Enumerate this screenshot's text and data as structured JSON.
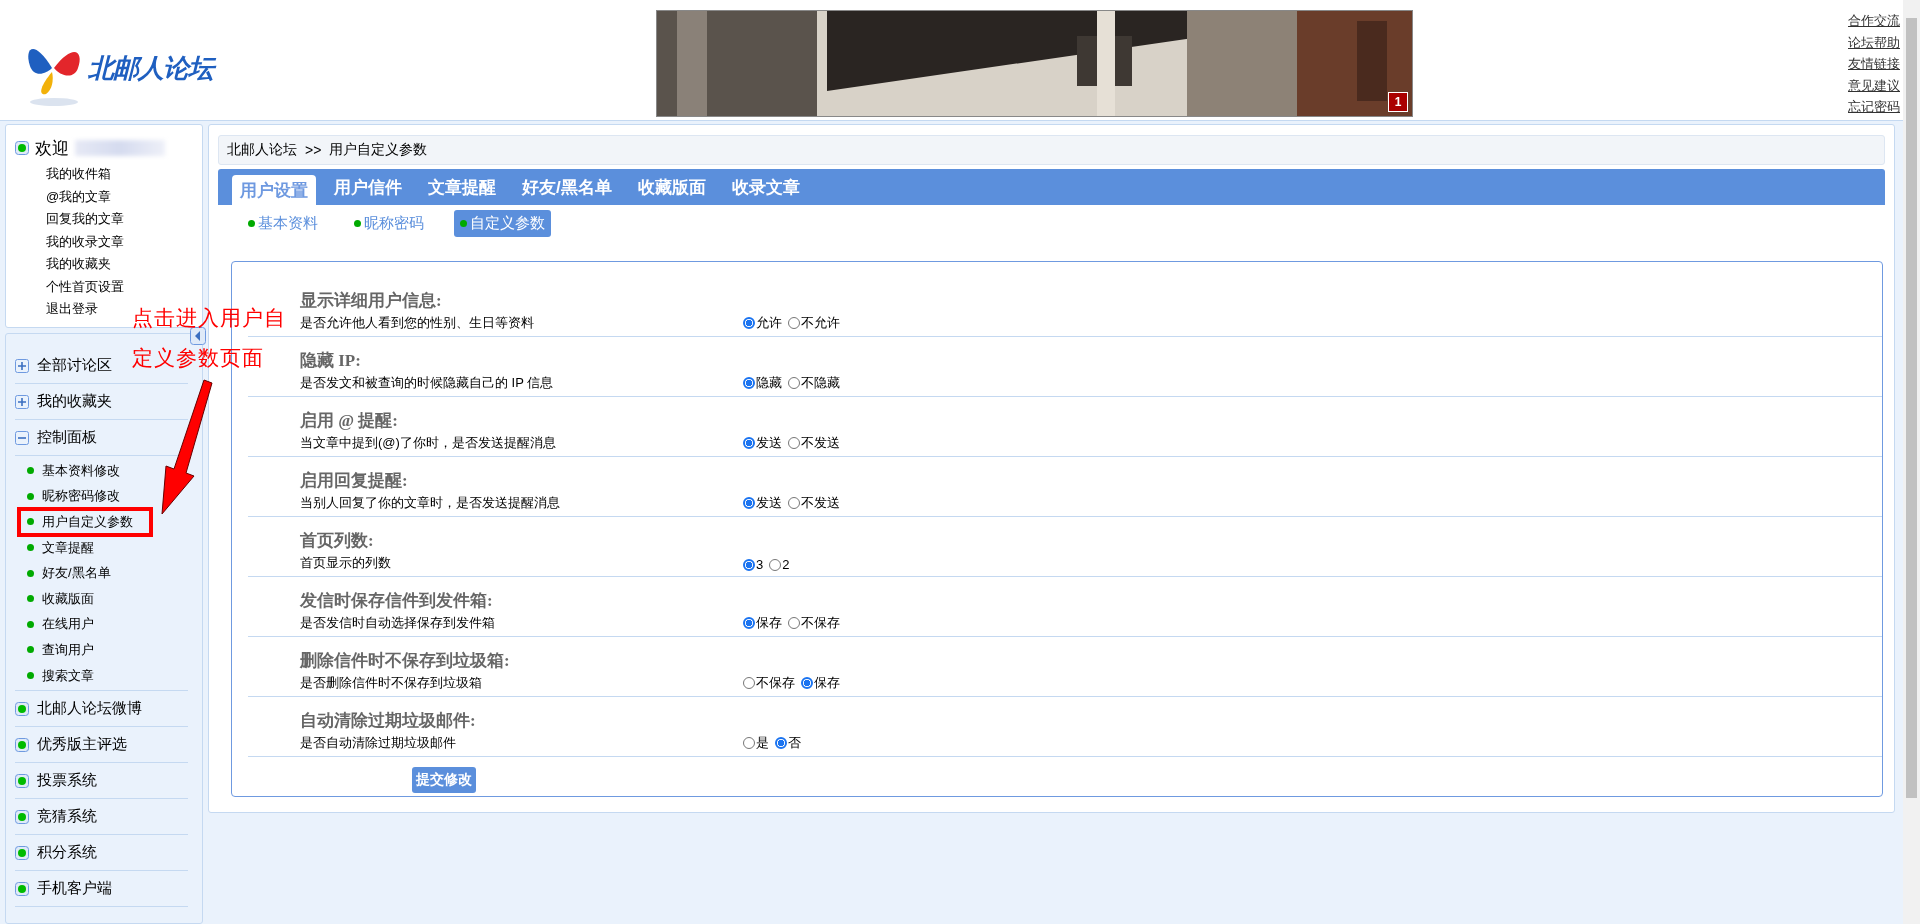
{
  "header": {
    "logo_text": "北邮人论坛",
    "banner_badge": "1",
    "links": [
      "合作交流",
      "论坛帮助",
      "友情链接",
      "意见建议",
      "忘记密码"
    ]
  },
  "welcome": {
    "title": "欢迎",
    "links": [
      "我的收件箱",
      "@我的文章",
      "回复我的文章",
      "我的收录文章",
      "我的收藏夹",
      "个性首页设置",
      "退出登录"
    ]
  },
  "sidebar": [
    {
      "label": "全部讨论区",
      "kind": "folder",
      "expanded": false
    },
    {
      "label": "我的收藏夹",
      "kind": "folder",
      "expanded": false
    },
    {
      "label": "控制面板",
      "kind": "folder",
      "expanded": true,
      "children": [
        {
          "label": "基本资料修改",
          "highlighted": false
        },
        {
          "label": "昵称密码修改",
          "highlighted": false
        },
        {
          "label": "用户自定义参数",
          "highlighted": true
        },
        {
          "label": "文章提醒",
          "highlighted": false
        },
        {
          "label": "好友/黑名单",
          "highlighted": false
        },
        {
          "label": "收藏版面",
          "highlighted": false
        },
        {
          "label": "在线用户",
          "highlighted": false
        },
        {
          "label": "查询用户",
          "highlighted": false
        },
        {
          "label": "搜索文章",
          "highlighted": false
        }
      ]
    },
    {
      "label": "北邮人论坛微博",
      "kind": "link"
    },
    {
      "label": "优秀版主评选",
      "kind": "link"
    },
    {
      "label": "投票系统",
      "kind": "link"
    },
    {
      "label": "竞猜系统",
      "kind": "link"
    },
    {
      "label": "积分系统",
      "kind": "link"
    },
    {
      "label": "手机客户端",
      "kind": "link"
    }
  ],
  "breadcrumb": {
    "items": [
      "北邮人论坛",
      "用户自定义参数"
    ],
    "separator": ">>"
  },
  "tabs": [
    {
      "label": "用户设置",
      "selected": true
    },
    {
      "label": "用户信件",
      "selected": false
    },
    {
      "label": "文章提醒",
      "selected": false
    },
    {
      "label": "好友/黑名单",
      "selected": false
    },
    {
      "label": "收藏版面",
      "selected": false
    },
    {
      "label": "收录文章",
      "selected": false
    }
  ],
  "subtabs": [
    {
      "label": "基本资料",
      "selected": false
    },
    {
      "label": "昵称密码",
      "selected": false
    },
    {
      "label": "自定义参数",
      "selected": true
    }
  ],
  "settings": [
    {
      "title": "显示详细用户信息:",
      "description": "是否允许他人看到您的性别、生日等资料",
      "options": [
        {
          "label": "允许",
          "selected": true
        },
        {
          "label": "不允许",
          "selected": false
        }
      ]
    },
    {
      "title": "隐藏 IP:",
      "description": "是否发文和被查询的时候隐藏自己的 IP 信息",
      "options": [
        {
          "label": "隐藏",
          "selected": true
        },
        {
          "label": "不隐藏",
          "selected": false
        }
      ]
    },
    {
      "title": "启用 @ 提醒:",
      "description": "当文章中提到(@)了你时，是否发送提醒消息",
      "options": [
        {
          "label": "发送",
          "selected": true
        },
        {
          "label": "不发送",
          "selected": false
        }
      ]
    },
    {
      "title": "启用回复提醒:",
      "description": "当别人回复了你的文章时，是否发送提醒消息",
      "options": [
        {
          "label": "发送",
          "selected": true
        },
        {
          "label": "不发送",
          "selected": false
        }
      ]
    },
    {
      "title": "首页列数:",
      "description": "首页显示的列数",
      "options": [
        {
          "label": "3",
          "selected": true
        },
        {
          "label": "2",
          "selected": false
        }
      ]
    },
    {
      "title": "发信时保存信件到发件箱:",
      "description": "是否发信时自动选择保存到发件箱",
      "options": [
        {
          "label": "保存",
          "selected": true
        },
        {
          "label": "不保存",
          "selected": false
        }
      ]
    },
    {
      "title": "删除信件时不保存到垃圾箱:",
      "description": "是否删除信件时不保存到垃圾箱",
      "options": [
        {
          "label": "不保存",
          "selected": false
        },
        {
          "label": "保存",
          "selected": true
        }
      ]
    },
    {
      "title": "自动清除过期垃圾邮件:",
      "description": "是否自动清除过期垃圾邮件",
      "options": [
        {
          "label": "是",
          "selected": false
        },
        {
          "label": "否",
          "selected": true
        }
      ]
    }
  ],
  "submit": "提交修改",
  "annotation": {
    "lines": [
      "点击进入用户自",
      "定义参数页面"
    ]
  }
}
